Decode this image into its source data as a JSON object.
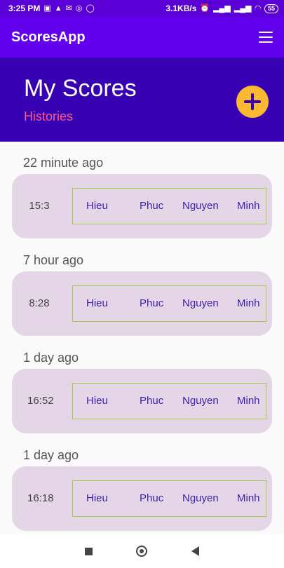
{
  "status_bar": {
    "time": "3:25 PM",
    "left_icons": [
      "image-icon",
      "warning-icon",
      "mail-icon",
      "antenna-icon",
      "whatsapp-icon"
    ],
    "net_speed": "3.1KB/s",
    "right_icons": [
      "alarm-icon",
      "signal-icon",
      "signal-icon",
      "wifi-icon"
    ],
    "battery": "55"
  },
  "app_bar": {
    "title": "ScoresApp",
    "menu_icon": "menu-icon"
  },
  "header": {
    "title": "My Scores",
    "subtitle": "Histories",
    "add_icon": "add-icon"
  },
  "colors": {
    "status_bar": "#5a00d6",
    "app_bar": "#6200ee",
    "header": "#3700b3",
    "subtitle": "#ff5a8a",
    "fab": "#f9b931",
    "card": "#e4d6e6",
    "card_border": "#a3c94a",
    "player_text": "#3b1fb0"
  },
  "entries": [
    {
      "time_ago": "22 minute ago",
      "score": "15:3",
      "players": [
        "Hieu",
        "Phuc",
        "Nguyen",
        "Minh"
      ]
    },
    {
      "time_ago": "7 hour ago",
      "score": "8:28",
      "players": [
        "Hieu",
        "Phuc",
        "Nguyen",
        "Minh"
      ]
    },
    {
      "time_ago": "1 day ago",
      "score": "16:52",
      "players": [
        "Hieu",
        "Phuc",
        "Nguyen",
        "Minh"
      ]
    },
    {
      "time_ago": "1 day ago",
      "score": "16:18",
      "players": [
        "Hieu",
        "Phuc",
        "Nguyen",
        "Minh"
      ]
    }
  ],
  "nav_bar": {
    "icons": [
      "recents-icon",
      "home-icon",
      "back-icon"
    ]
  }
}
